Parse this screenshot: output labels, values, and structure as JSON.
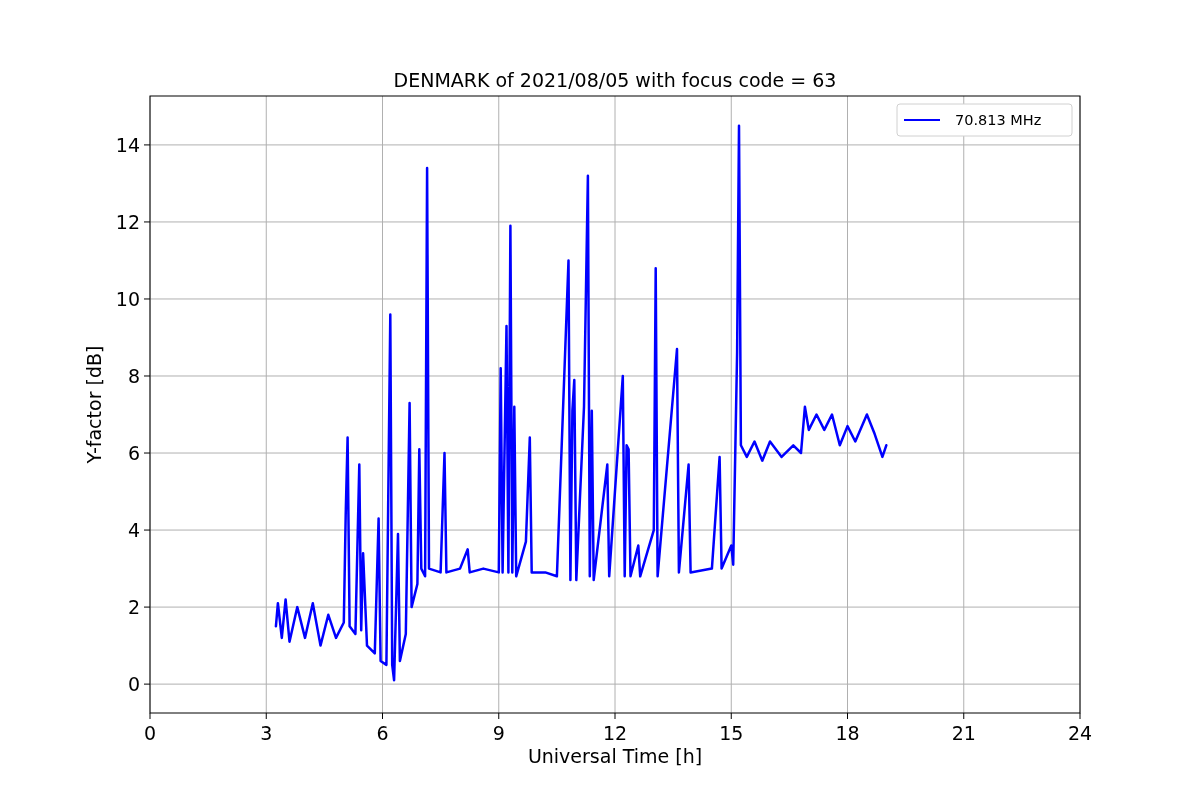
{
  "chart_data": {
    "type": "line",
    "title": "DENMARK of 2021/08/05 with focus code = 63",
    "xlabel": "Universal Time [h]",
    "ylabel": "Y-factor [dB]",
    "x": [
      3.25,
      3.3,
      3.4,
      3.5,
      3.6,
      3.8,
      4.0,
      4.2,
      4.4,
      4.6,
      4.8,
      5.0,
      5.05,
      5.1,
      5.15,
      5.3,
      5.4,
      5.45,
      5.5,
      5.6,
      5.8,
      5.9,
      5.95,
      6.1,
      6.2,
      6.25,
      6.3,
      6.4,
      6.45,
      6.6,
      6.7,
      6.75,
      6.9,
      6.95,
      7.0,
      7.1,
      7.15,
      7.2,
      7.5,
      7.6,
      7.65,
      8.0,
      8.2,
      8.25,
      8.6,
      9.0,
      9.05,
      9.1,
      9.2,
      9.25,
      9.3,
      9.35,
      9.4,
      9.45,
      9.7,
      9.8,
      9.85,
      10.2,
      10.5,
      10.8,
      10.85,
      10.9,
      10.95,
      11.0,
      11.2,
      11.3,
      11.35,
      11.4,
      11.45,
      11.8,
      11.85,
      12.2,
      12.25,
      12.3,
      12.35,
      12.4,
      12.6,
      12.65,
      13.0,
      13.05,
      13.1,
      13.6,
      13.65,
      13.9,
      13.95,
      14.5,
      14.7,
      14.75,
      15.0,
      15.05,
      15.15,
      15.2,
      15.25,
      15.4,
      15.6,
      15.8,
      16.0,
      16.3,
      16.6,
      16.8,
      16.9,
      17.0,
      17.2,
      17.4,
      17.6,
      17.8,
      18.0,
      18.2,
      18.5,
      18.7,
      18.9,
      19.0
    ],
    "series": [
      {
        "name": "70.813 MHz",
        "color": "#0000ff",
        "values": [
          1.5,
          2.1,
          1.2,
          2.2,
          1.1,
          2.0,
          1.2,
          2.1,
          1.0,
          1.8,
          1.2,
          1.6,
          4.4,
          6.4,
          1.5,
          1.3,
          5.7,
          1.4,
          3.4,
          1.0,
          0.8,
          4.3,
          0.6,
          0.5,
          9.6,
          0.5,
          0.1,
          3.9,
          0.6,
          1.3,
          7.3,
          2.0,
          2.6,
          6.1,
          3.0,
          2.8,
          13.4,
          3.0,
          2.9,
          6.0,
          2.9,
          3.0,
          3.5,
          2.9,
          3.0,
          2.9,
          8.2,
          2.9,
          9.3,
          2.9,
          11.9,
          2.9,
          7.2,
          2.8,
          3.7,
          6.4,
          2.9,
          2.9,
          2.8,
          11.0,
          2.7,
          7.1,
          7.9,
          2.7,
          7.2,
          13.2,
          2.8,
          7.1,
          2.7,
          5.7,
          2.8,
          8.0,
          2.8,
          6.2,
          6.1,
          2.8,
          3.6,
          2.8,
          4.0,
          10.8,
          2.8,
          8.7,
          2.9,
          5.7,
          2.9,
          3.0,
          5.9,
          3.0,
          3.6,
          3.1,
          8.6,
          14.5,
          6.2,
          5.9,
          6.3,
          5.8,
          6.3,
          5.9,
          6.2,
          6.0,
          7.2,
          6.6,
          7.0,
          6.6,
          7.0,
          6.2,
          6.7,
          6.3,
          7.0,
          6.5,
          5.9,
          6.2
        ]
      }
    ],
    "xlim": [
      0,
      24
    ],
    "ylim": [
      -0.75,
      15.27
    ],
    "xticks": [
      0,
      3,
      6,
      9,
      12,
      15,
      18,
      21,
      24
    ],
    "grid": true,
    "yticks": [
      0,
      2,
      4,
      6,
      8,
      10,
      12,
      14
    ]
  }
}
